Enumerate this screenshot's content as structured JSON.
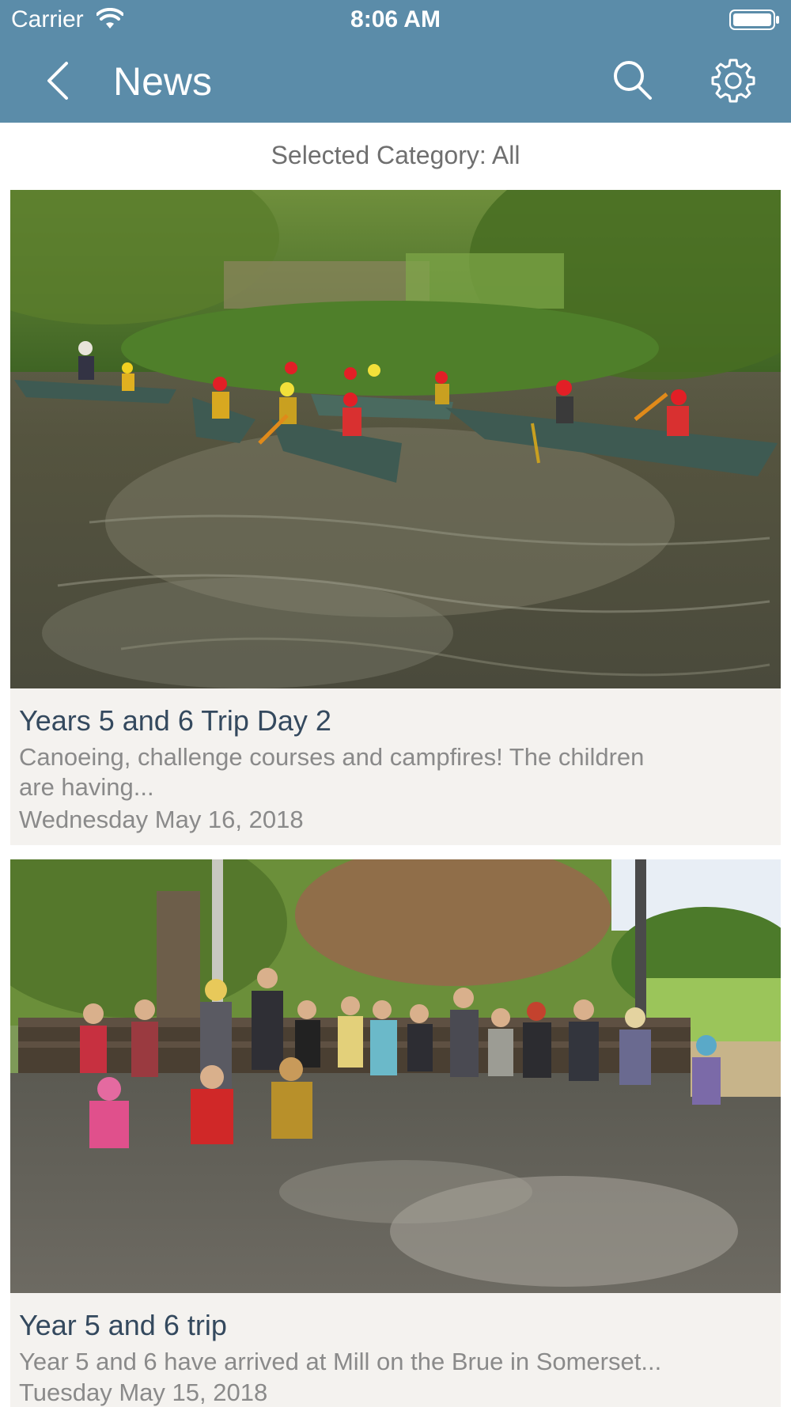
{
  "colors": {
    "accent": "#5b8ca9",
    "title": "#34495e",
    "muted": "#8a8a8a",
    "card_bg": "#f4f2ef"
  },
  "status_bar": {
    "carrier": "Carrier",
    "time": "8:06 AM",
    "icons": [
      "wifi-icon",
      "battery-icon"
    ]
  },
  "nav": {
    "title": "News",
    "icons": [
      "back-chevron-icon",
      "search-icon",
      "gear-icon"
    ]
  },
  "category": {
    "label": "Selected Category: All"
  },
  "articles": [
    {
      "title": "Years 5 and 6 Trip Day 2",
      "summary": "Canoeing, challenge courses and campfires! The children are having...",
      "date": "Wednesday May 16, 2018",
      "image": "photo of children canoeing on a river"
    },
    {
      "title": "Year 5 and 6 trip",
      "summary": "Year 5 and 6 have arrived at Mill on the Brue in Somerset...",
      "date": "Tuesday May 15, 2018",
      "image": "group photo of children on a bench under a tree"
    }
  ]
}
